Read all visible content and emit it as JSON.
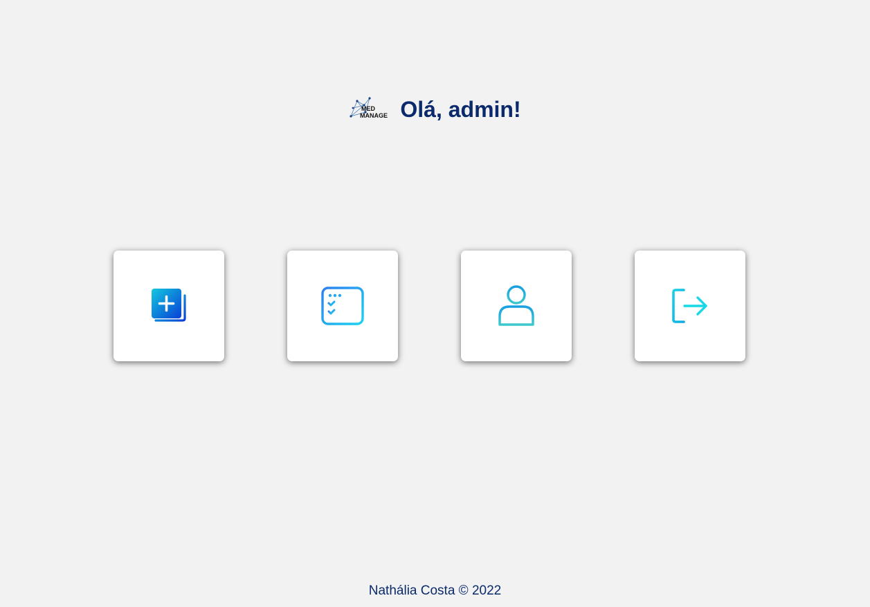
{
  "header": {
    "logo_text_line1": "MED",
    "logo_text_line2": "MANAGE",
    "greeting": "Olá, admin!"
  },
  "cards": [
    {
      "icon": "add-document-icon"
    },
    {
      "icon": "checklist-icon"
    },
    {
      "icon": "user-icon"
    },
    {
      "icon": "logout-icon"
    }
  ],
  "footer": {
    "text": "Nathália Costa © 2022"
  },
  "colors": {
    "background": "#f2f2f2",
    "heading": "#0b2a6b",
    "icon_blue": "#0a4fd6",
    "icon_cyan": "#19d8e6"
  }
}
